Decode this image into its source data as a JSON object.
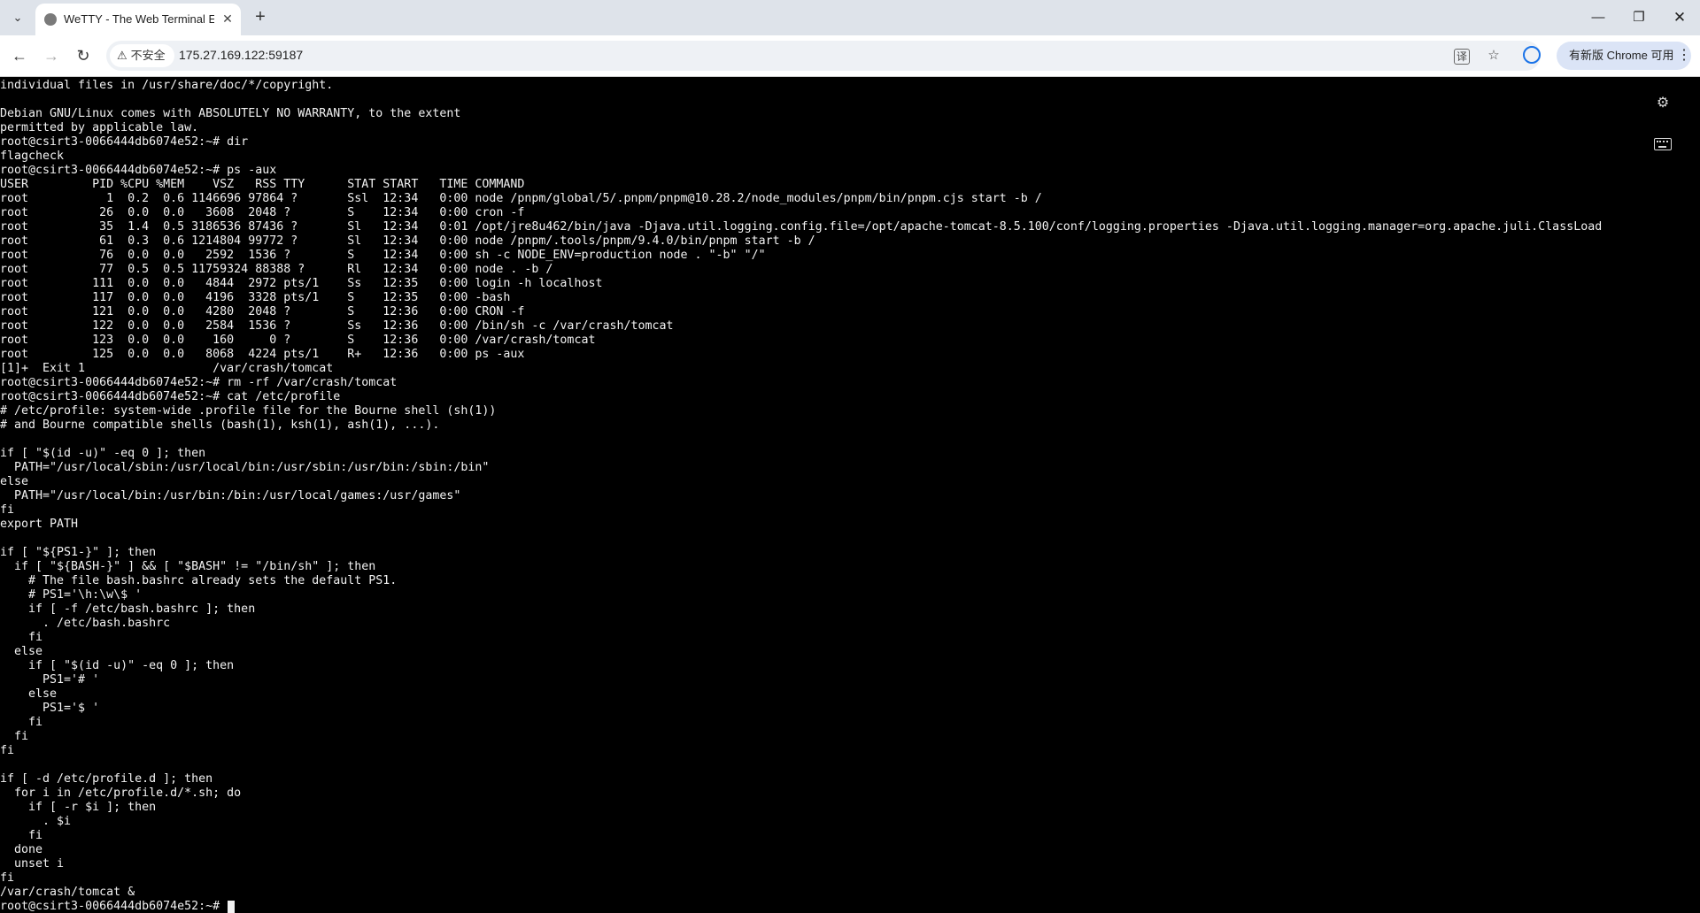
{
  "browser": {
    "tab": {
      "title": "WeTTY - The Web Terminal E",
      "favicon": "globe-icon",
      "close": "✕"
    },
    "new_tab": "+",
    "window": {
      "minimize": "—",
      "restore": "❐",
      "close": "✕"
    },
    "nav": {
      "back": "←",
      "forward": "→",
      "reload": "↻"
    },
    "omnibox": {
      "security_label": "不安全",
      "security_icon": "⚠",
      "url": "175.27.169.122:59187",
      "translate_icon": "译",
      "star_icon": "☆"
    },
    "update_chip": {
      "label": "有新版 Chrome 可用",
      "more": "⋮"
    }
  },
  "terminal": {
    "controls": {
      "settings_icon": "⚙",
      "keyboard_icon": "keyboard-icon"
    },
    "lines": [
      "individual files in /usr/share/doc/*/copyright.",
      "",
      "Debian GNU/Linux comes with ABSOLUTELY NO WARRANTY, to the extent",
      "permitted by applicable law.",
      "root@csirt3-0066444db6074e52:~# dir",
      "flagcheck",
      "root@csirt3-0066444db6074e52:~# ps -aux",
      "USER         PID %CPU %MEM    VSZ   RSS TTY      STAT START   TIME COMMAND",
      "root           1  0.2  0.6 1146696 97864 ?       Ssl  12:34   0:00 node /pnpm/global/5/.pnpm/pnpm@10.28.2/node_modules/pnpm/bin/pnpm.cjs start -b /",
      "root          26  0.0  0.0   3608  2048 ?        S    12:34   0:00 cron -f",
      "root          35  1.4  0.5 3186536 87436 ?       Sl   12:34   0:01 /opt/jre8u462/bin/java -Djava.util.logging.config.file=/opt/apache-tomcat-8.5.100/conf/logging.properties -Djava.util.logging.manager=org.apache.juli.ClassLoad",
      "root          61  0.3  0.6 1214804 99772 ?       Sl   12:34   0:00 node /pnpm/.tools/pnpm/9.4.0/bin/pnpm start -b /",
      "root          76  0.0  0.0   2592  1536 ?        S    12:34   0:00 sh -c NODE_ENV=production node . \"-b\" \"/\"",
      "root          77  0.5  0.5 11759324 88388 ?      Rl   12:34   0:00 node . -b /",
      "root         111  0.0  0.0   4844  2972 pts/1    Ss   12:35   0:00 login -h localhost",
      "root         117  0.0  0.0   4196  3328 pts/1    S    12:35   0:00 -bash",
      "root         121  0.0  0.0   4280  2048 ?        S    12:36   0:00 CRON -f",
      "root         122  0.0  0.0   2584  1536 ?        Ss   12:36   0:00 /bin/sh -c /var/crash/tomcat",
      "root         123  0.0  0.0    160     0 ?        S    12:36   0:00 /var/crash/tomcat",
      "root         125  0.0  0.0   8068  4224 pts/1    R+   12:36   0:00 ps -aux",
      "[1]+  Exit 1                  /var/crash/tomcat",
      "root@csirt3-0066444db6074e52:~# rm -rf /var/crash/tomcat",
      "root@csirt3-0066444db6074e52:~# cat /etc/profile",
      "# /etc/profile: system-wide .profile file for the Bourne shell (sh(1))",
      "# and Bourne compatible shells (bash(1), ksh(1), ash(1), ...).",
      "",
      "if [ \"$(id -u)\" -eq 0 ]; then",
      "  PATH=\"/usr/local/sbin:/usr/local/bin:/usr/sbin:/usr/bin:/sbin:/bin\"",
      "else",
      "  PATH=\"/usr/local/bin:/usr/bin:/bin:/usr/local/games:/usr/games\"",
      "fi",
      "export PATH",
      "",
      "if [ \"${PS1-}\" ]; then",
      "  if [ \"${BASH-}\" ] && [ \"$BASH\" != \"/bin/sh\" ]; then",
      "    # The file bash.bashrc already sets the default PS1.",
      "    # PS1='\\h:\\w\\$ '",
      "    if [ -f /etc/bash.bashrc ]; then",
      "      . /etc/bash.bashrc",
      "    fi",
      "  else",
      "    if [ \"$(id -u)\" -eq 0 ]; then",
      "      PS1='# '",
      "    else",
      "      PS1='$ '",
      "    fi",
      "  fi",
      "fi",
      "",
      "if [ -d /etc/profile.d ]; then",
      "  for i in /etc/profile.d/*.sh; do",
      "    if [ -r $i ]; then",
      "      . $i",
      "    fi",
      "  done",
      "  unset i",
      "fi",
      "/var/crash/tomcat &",
      "root@csirt3-0066444db6074e52:~# "
    ]
  }
}
